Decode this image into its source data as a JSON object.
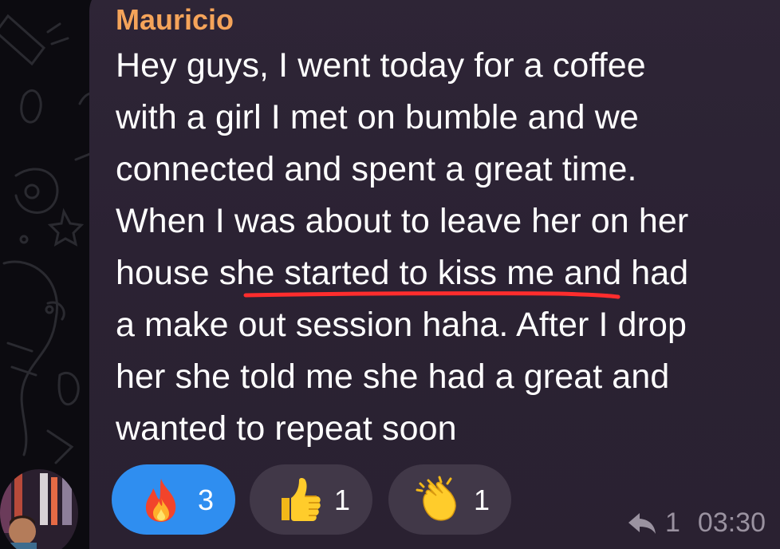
{
  "message": {
    "sender": "Mauricio",
    "lines": [
      "Hey guys, I went today for a coffee",
      "with a girl I met on bumble and we",
      "connected and spent a great time.",
      "When I was about to leave her on her",
      "house she started to kiss me and had",
      "a make out session haha. After I drop",
      "her she told me she had a great and",
      "wanted to repeat soon"
    ],
    "underlined_phrase": "she started to kiss me",
    "underline_color": "#ff2d2d"
  },
  "reactions": [
    {
      "emoji": "fire-icon",
      "count": "3",
      "active": true
    },
    {
      "emoji": "thumbs-up-icon",
      "count": "1",
      "active": false
    },
    {
      "emoji": "clapping-hands-icon",
      "count": "1",
      "active": false
    }
  ],
  "meta": {
    "reply_count": "1",
    "time": "03:30"
  },
  "colors": {
    "bubble": "#2e2536",
    "sender": "#f5a45a",
    "active_reaction": "#2f8ef0",
    "inactive_reaction": "#413848"
  }
}
